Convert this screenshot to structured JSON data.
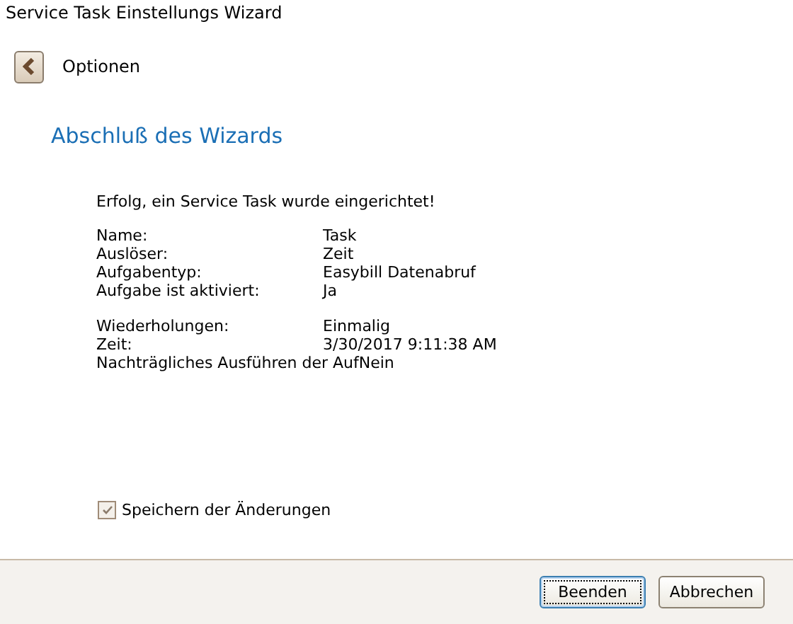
{
  "window": {
    "title": "Service Task Einstellungs Wizard"
  },
  "nav": {
    "back_label": "Optionen"
  },
  "heading": "Abschluß des Wizards",
  "message": "Erfolg, ein Service Task wurde eingerichtet!",
  "summary": {
    "groups": [
      [
        {
          "label": "Name:",
          "value": "Task"
        },
        {
          "label": "Auslöser:",
          "value": "Zeit"
        },
        {
          "label": "Aufgabentyp:",
          "value": "Easybill Datenabruf"
        },
        {
          "label": "Aufgabe ist aktiviert:",
          "value": "Ja"
        }
      ],
      [
        {
          "label": "Wiederholungen:",
          "value": "Einmalig"
        },
        {
          "label": "Zeit:",
          "value": "3/30/2017 9:11:38 AM"
        },
        {
          "label": "Nachträgliches Ausführen der Auf",
          "value": "Nein"
        }
      ]
    ]
  },
  "save_changes": {
    "label": "Speichern der Änderungen",
    "checked": true
  },
  "buttons": [
    {
      "label": "Beenden",
      "selected": true
    },
    {
      "label": "Abbrechen",
      "selected": false
    }
  ]
}
